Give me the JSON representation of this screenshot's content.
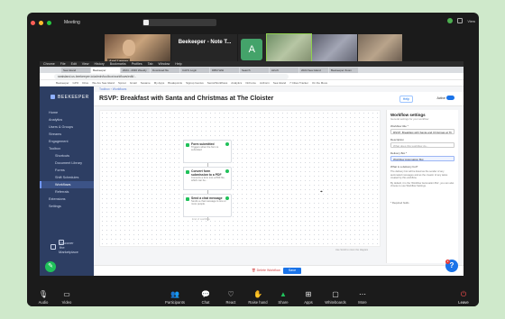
{
  "zoom": {
    "title": "Meeting",
    "view_label": "View",
    "participants": [
      {
        "name": "Axel Lesser"
      },
      {
        "name": "Beekeeper - Note T..."
      },
      {
        "name": ""
      },
      {
        "name": ""
      },
      {
        "name": ""
      },
      {
        "name": ""
      }
    ],
    "avatar_letter": "A",
    "controls": {
      "audio": "Audio",
      "video": "Video",
      "participants": "Participants",
      "participants_count": "6",
      "chat": "Chat",
      "react": "React",
      "raise_hand": "Raise hand",
      "share": "Share",
      "apps": "Apps",
      "whiteboards": "Whiteboards",
      "more": "More",
      "leave": "Leave"
    }
  },
  "mac_menu": [
    "Chrome",
    "File",
    "Edit",
    "View",
    "History",
    "Bookmarks",
    "Profiles",
    "Tab",
    "Window",
    "Help"
  ],
  "browser": {
    "tabs": [
      "Sea Island",
      "Beekeeper",
      "2024 - 2030 Weekly",
      "Download file",
      "CAFS Login",
      "DBM Wiki",
      "Search",
      "AirLift",
      "2024 Sea Island",
      "Beekeeper Zoom"
    ],
    "url": "seaisland.us.beekeeper.io/admin/toolbox/workflows/edit/...",
    "bookmarks": [
      "Beekeeper",
      "GPO",
      "Drive",
      "We Are Sea Island",
      "Sprout",
      "Gmail",
      "Sesame",
      "My Apps",
      "Breakpoints",
      "Signup Genius",
      "SeniorWorkflows",
      "Analytics",
      "OnForce",
      "JotForm",
      "Sea Island",
      "7 Cities Tracker",
      "On the Move"
    ]
  },
  "beekeeper": {
    "logo": "BEEKEEPER",
    "nav": [
      {
        "label": "Home",
        "active": false,
        "sub": false
      },
      {
        "label": "Analytics",
        "active": false,
        "sub": false
      },
      {
        "label": "Users & Groups",
        "active": false,
        "sub": false
      },
      {
        "label": "Streams",
        "active": false,
        "sub": false
      },
      {
        "label": "Engagement",
        "active": false,
        "sub": false
      },
      {
        "label": "Toolbox",
        "active": false,
        "sub": false
      },
      {
        "label": "Shortcuts",
        "active": false,
        "sub": true
      },
      {
        "label": "Document Library",
        "active": false,
        "sub": true
      },
      {
        "label": "Forms",
        "active": false,
        "sub": true
      },
      {
        "label": "Shift Schedules",
        "active": false,
        "sub": true
      },
      {
        "label": "Workflows",
        "active": true,
        "sub": true
      },
      {
        "label": "Referrals",
        "active": false,
        "sub": true
      },
      {
        "label": "Extensions",
        "active": false,
        "sub": false
      },
      {
        "label": "Settings",
        "active": false,
        "sub": false
      }
    ],
    "marketplace_line1": "Discover the",
    "marketplace_line2": "Marketplace",
    "breadcrumb": "Toolbox  ›  Workflows",
    "page_title": "RSVP: Breakfast with Santa and Christmas at The Cloister",
    "help_label": "Help",
    "active_label": "Active",
    "steps": [
      {
        "title": "Form submitted",
        "desc": "Triggers when the form is submitted"
      },
      {
        "title": "Convert form submission to a PDF",
        "desc": "Converts a form into a PDF file, which can be..."
      },
      {
        "title": "Send a chat message",
        "desc": "Sends a chat message to one or more people."
      }
    ],
    "end_label": "End of workflow",
    "canvas_hint": "Use Scroll to zoom the diagram",
    "settings": {
      "title": "Workflow settings",
      "subtitle": "General settings for your workflow",
      "title_label": "Workflow title *",
      "title_value": "RSVP: Breakfast with Santa and Christmas at Th",
      "desc_label": "Description",
      "desc_placeholder": "What does this workflow do...",
      "owner_label": "Delivery Bot *",
      "owner_value": "Workflow Automation Bot",
      "owner_help": "What is a delivery bot?",
      "owner_text": "The delivery bot will be listed as the sender of any automated messages and as the creator of any tasks created by this workflow.",
      "owner_text2": "By default, it is the 'Workflow Automation Bot', you can also choose to use Workflow Settings.",
      "required_note": "* Required fields"
    },
    "delete_label": "Delete Workflow",
    "save_label": "Save",
    "help_badge": "3"
  }
}
